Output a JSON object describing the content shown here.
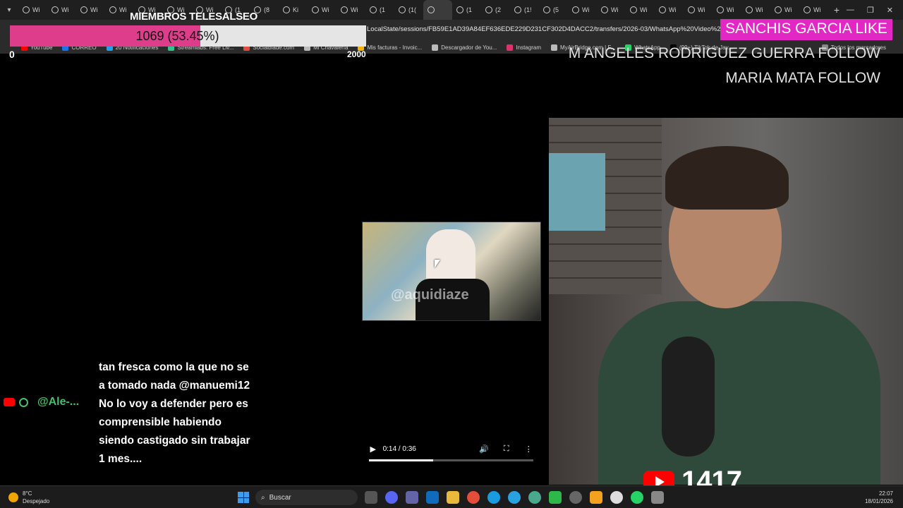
{
  "browser": {
    "tab_labels": [
      "Wi",
      "Wi",
      "Wi",
      "Wi",
      "Wi",
      "Wi",
      "Wi",
      "(1",
      "(8",
      "Ki",
      "Wi",
      "Wi",
      "(1",
      "(1(",
      "",
      "(1",
      "(2",
      "(1!",
      "(5",
      "Wi",
      "Wi",
      "Wi",
      "Wi",
      "Wi",
      "Wi",
      "Wi",
      "Wi",
      "Wi"
    ],
    "url": "LocalState/sessions/FB59E1AD39A84EF636EDE229D231CF302D4DACC2/transfers/2026-03/WhatsApp%20Video%202026-",
    "bookmarks": [
      "YouTube",
      "CORREO",
      "20 Notificaciones",
      "Streamlabs: Free Liv...",
      "Socialblade.com",
      "Mi Chavalería",
      "Mis facturas - Invoic...",
      "Descargador de You...",
      "Instagram",
      "MyAirBridge.com | F...",
      "WhatsApp",
      "(99+) TikTok de Jav..."
    ],
    "bookmarks_all": "Todos los marcadores"
  },
  "overlay": {
    "members_title": "MIEMBROS TELESALSEO",
    "goal_text": "1069 (53.45%)",
    "goal_fraction": 0.5345,
    "goal_min": "0",
    "goal_max": "2000",
    "like_alert": "SANCHIS GARCIA  LIKE",
    "follow_1": "M ANGELES RODRIGUEZ GUERRA  FOLLOW",
    "follow_2": "MARIA MATA  FOLLOW",
    "viewer_count": "1417",
    "chat_user": "@Ale-...",
    "chat_message": "tan fresca como la que no se a tomado nada @manuemi12 No lo voy a defender pero es comprensible habiendo siendo castigado sin trabajar 1 mes...."
  },
  "video_player": {
    "watermark": "@aquidiaze",
    "time": "0:14 / 0:36",
    "progress_fraction": 0.39
  },
  "taskbar": {
    "temperature": "8°C",
    "weather": "Despejado",
    "search_label": "Buscar",
    "time": "22:07",
    "date": "18/01/2026"
  },
  "colors": {
    "accent_pink": "#dd3d8a",
    "like_magenta": "#e227c5",
    "chat_green": "#3ec26a",
    "youtube_red": "#ff0000"
  }
}
